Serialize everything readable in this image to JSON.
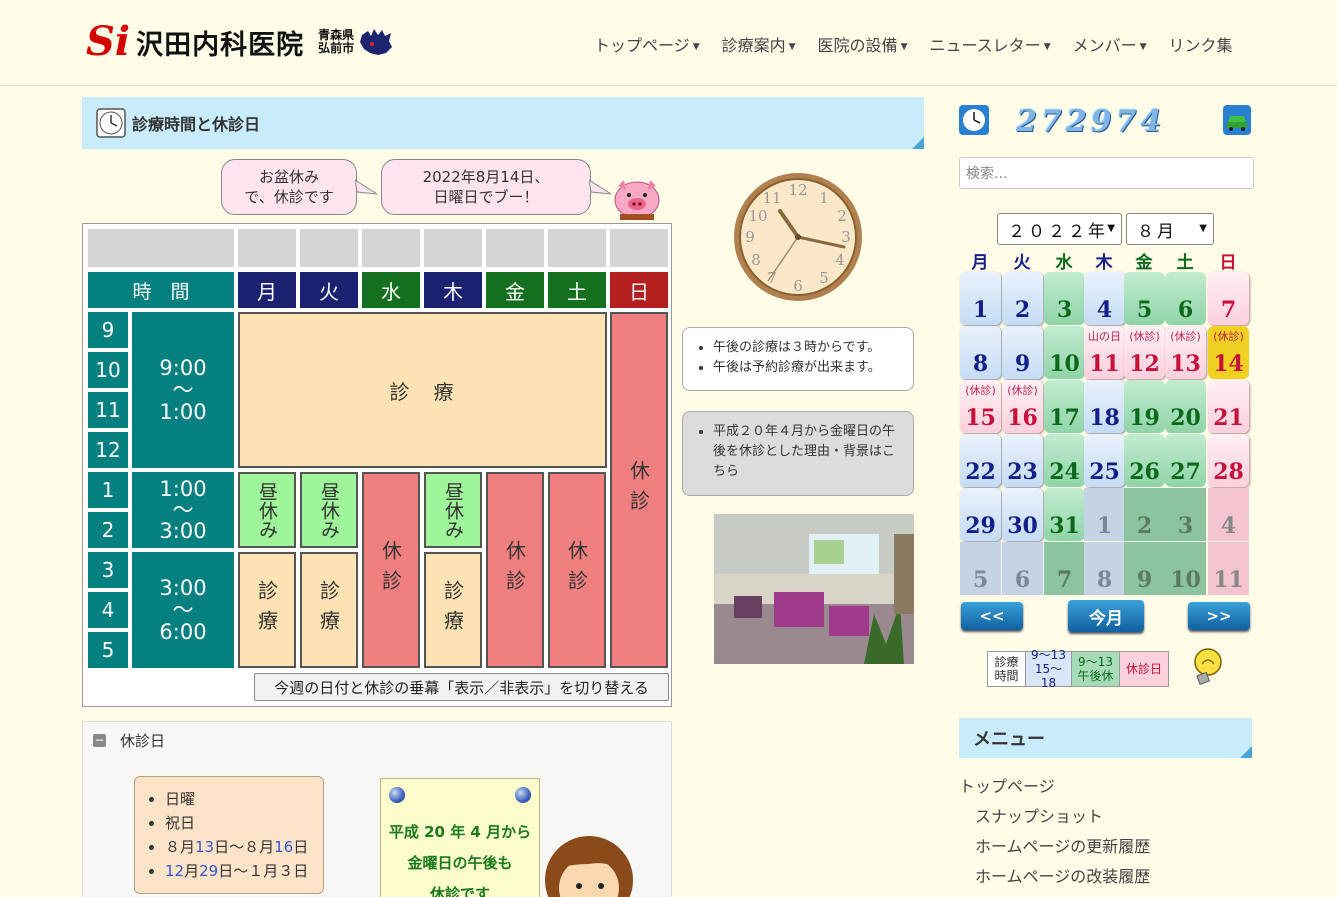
{
  "header": {
    "logo_mark": "Si",
    "logo_name": "沢田内科医院",
    "logo_pref": "青森県",
    "logo_city": "弘前市",
    "nav": [
      {
        "label": "トップページ",
        "dropdown": true
      },
      {
        "label": "診療案内",
        "dropdown": true
      },
      {
        "label": "医院の設備",
        "dropdown": true
      },
      {
        "label": "ニュースレター",
        "dropdown": true
      },
      {
        "label": "メンバー",
        "dropdown": true
      },
      {
        "label": "リンク集",
        "dropdown": false
      }
    ]
  },
  "section": {
    "title": "診療時間と休診日"
  },
  "bubbles": {
    "left_line1": "お盆休み",
    "left_line2": "で、休診です",
    "right_line1": "2022年8月14日、",
    "right_line2": "日曜日でブー！"
  },
  "schedule": {
    "time_header": "時　間",
    "days": [
      "月",
      "火",
      "水",
      "木",
      "金",
      "土",
      "日"
    ],
    "hours": [
      "9",
      "10",
      "11",
      "12",
      "1",
      "2",
      "3",
      "4",
      "5"
    ],
    "slot1": {
      "start": "9:00",
      "tilde": "〜",
      "end": "1:00"
    },
    "slot2": {
      "start": "1:00",
      "tilde": "〜",
      "end": "3:00"
    },
    "slot3": {
      "start": "3:00",
      "tilde": "〜",
      "end": "6:00"
    },
    "morning": "診　療",
    "lunch": "昼休み",
    "closed": "休診",
    "consult": "診療",
    "toggle_button": "今週の日付と休診の垂幕「表示／非表示」を切り替える"
  },
  "notes": {
    "n1": "午後の診療は３時からです。",
    "n2": "午後は予約診療が出来ます。",
    "n3": "平成２０年４月から金曜日の午後を休診とした理由・背景はこちら"
  },
  "closed_days": {
    "header": "休診日",
    "minus": "−",
    "items": [
      "日曜",
      "祝日"
    ],
    "obon": {
      "a": "８月",
      "b": "13",
      "c": "日～８月",
      "d": "16",
      "e": "日"
    },
    "newyear": {
      "a": "12",
      "b": "月",
      "c": "29",
      "d": "日～１月３日"
    },
    "notice_line1": "平成 20 年 4 月から",
    "notice_line2": "金曜日の午後も",
    "notice_line3": "休診です"
  },
  "counter": {
    "value": "272974"
  },
  "search": {
    "placeholder": "検索..."
  },
  "calendar": {
    "year_label": "２０２２年",
    "month_label": "８月",
    "weekdays": [
      "月",
      "火",
      "水",
      "木",
      "金",
      "土",
      "日"
    ],
    "weekday_colors": [
      "#14208a",
      "#14208a",
      "#0a6a1a",
      "#14208a",
      "#0a6a1a",
      "#0a6a1a",
      "#c8103c"
    ],
    "rows": [
      [
        {
          "d": "1",
          "t": "blue"
        },
        {
          "d": "2",
          "t": "blue"
        },
        {
          "d": "3",
          "t": "green"
        },
        {
          "d": "4",
          "t": "blue"
        },
        {
          "d": "5",
          "t": "green"
        },
        {
          "d": "6",
          "t": "green"
        },
        {
          "d": "7",
          "t": "pink"
        }
      ],
      [
        {
          "d": "8",
          "t": "blue"
        },
        {
          "d": "9",
          "t": "blue"
        },
        {
          "d": "10",
          "t": "green"
        },
        {
          "d": "11",
          "t": "pink",
          "h": "山の日"
        },
        {
          "d": "12",
          "t": "pink",
          "h": "(休診)"
        },
        {
          "d": "13",
          "t": "pink",
          "h": "(休診)"
        },
        {
          "d": "14",
          "t": "today",
          "h": "(休診)"
        }
      ],
      [
        {
          "d": "15",
          "t": "pink",
          "h": "(休診)"
        },
        {
          "d": "16",
          "t": "pink",
          "h": "(休診)"
        },
        {
          "d": "17",
          "t": "green"
        },
        {
          "d": "18",
          "t": "blue"
        },
        {
          "d": "19",
          "t": "green"
        },
        {
          "d": "20",
          "t": "green"
        },
        {
          "d": "21",
          "t": "pink"
        }
      ],
      [
        {
          "d": "22",
          "t": "blue"
        },
        {
          "d": "23",
          "t": "blue"
        },
        {
          "d": "24",
          "t": "green"
        },
        {
          "d": "25",
          "t": "blue"
        },
        {
          "d": "26",
          "t": "green"
        },
        {
          "d": "27",
          "t": "green"
        },
        {
          "d": "28",
          "t": "pink"
        }
      ],
      [
        {
          "d": "29",
          "t": "blue"
        },
        {
          "d": "30",
          "t": "blue"
        },
        {
          "d": "31",
          "t": "green"
        },
        {
          "d": "1",
          "t": "next-b"
        },
        {
          "d": "2",
          "t": "next-g"
        },
        {
          "d": "3",
          "t": "next-g"
        },
        {
          "d": "4",
          "t": "next-p"
        }
      ],
      [
        {
          "d": "5",
          "t": "next-b"
        },
        {
          "d": "6",
          "t": "next-b"
        },
        {
          "d": "7",
          "t": "next-g"
        },
        {
          "d": "8",
          "t": "next-b"
        },
        {
          "d": "9",
          "t": "next-g"
        },
        {
          "d": "10",
          "t": "next-g"
        },
        {
          "d": "11",
          "t": "next-p"
        }
      ]
    ],
    "prev": "<<",
    "today": "今月",
    "next": ">>"
  },
  "legend": {
    "l1a": "診療",
    "l1b": "時間",
    "l2a": "9〜13",
    "l2b": "15〜18",
    "l3a": "9〜13",
    "l3b": "午後休",
    "l4": "休診日"
  },
  "menu": {
    "title": "メニュー",
    "items": [
      "トップページ",
      "スナップショット",
      "ホームページの更新履歴",
      "ホームページの改装履歴"
    ]
  }
}
